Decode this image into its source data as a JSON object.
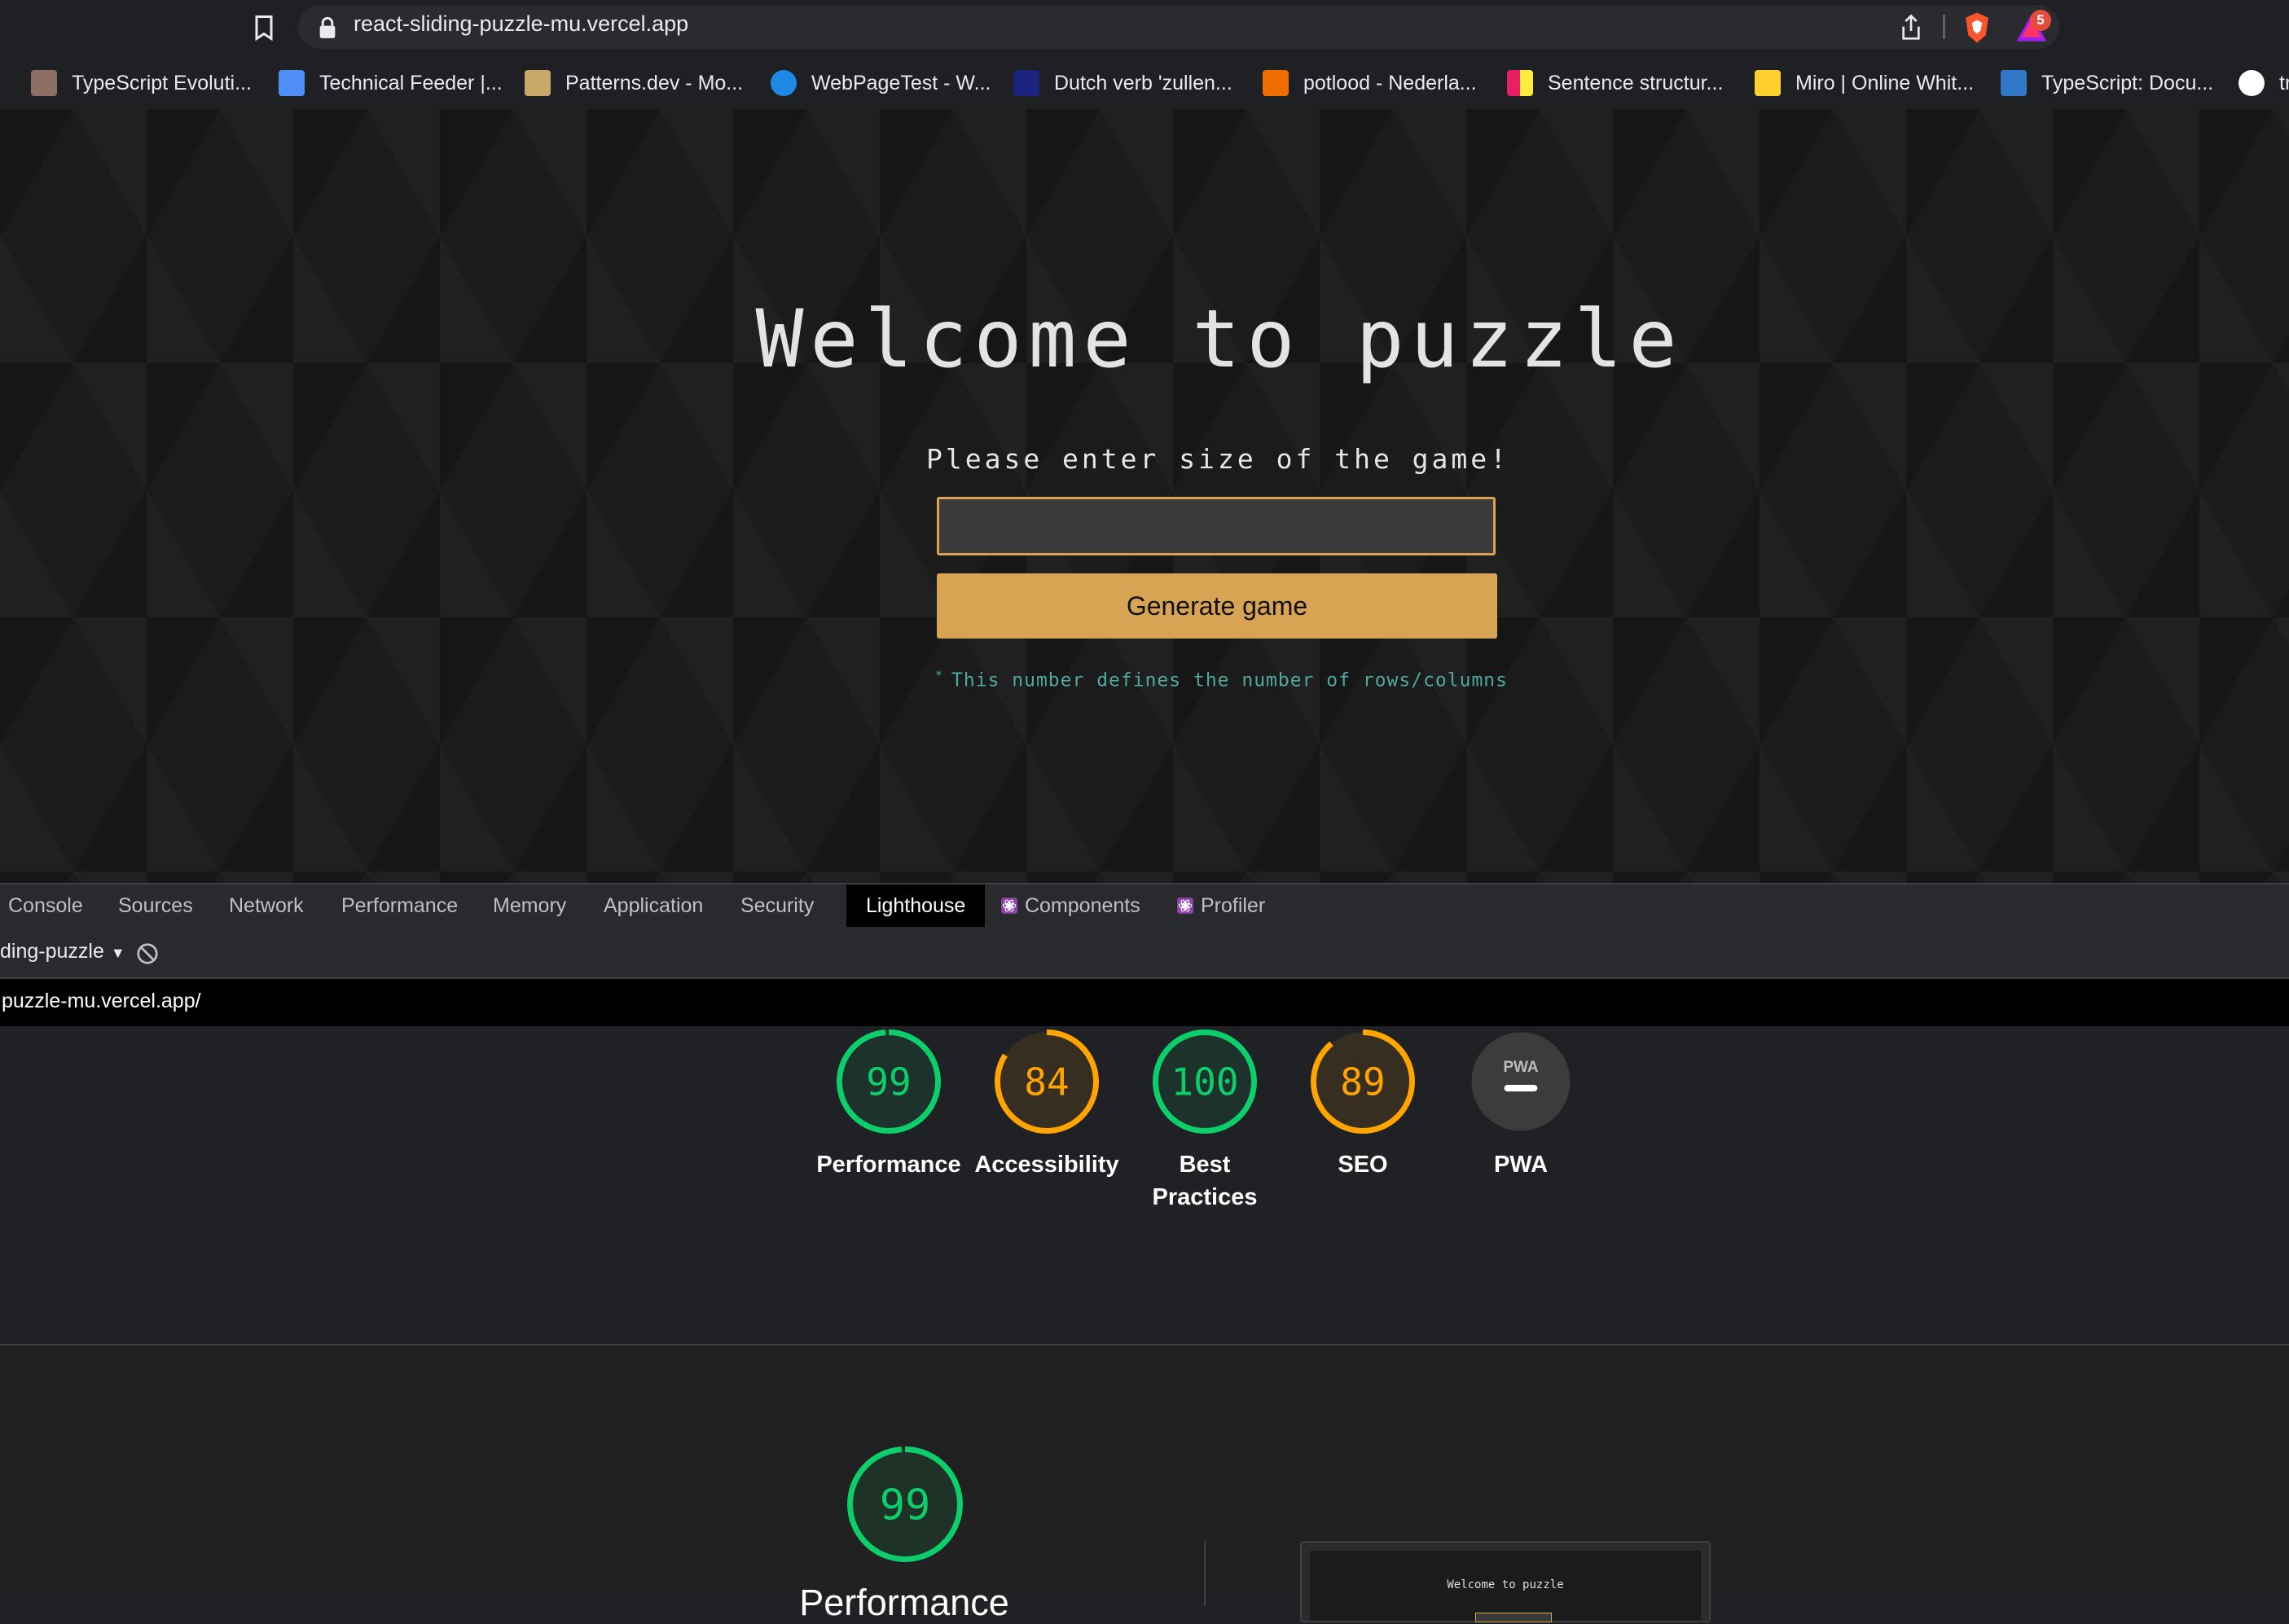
{
  "browser": {
    "url": "react-sliding-puzzle-mu.vercel.app",
    "rewards_badge": "5",
    "bookmarks": [
      {
        "label": "TypeScript Evoluti...",
        "icon": "avatar-favicon",
        "color": "#8d6e63"
      },
      {
        "label": "Technical Feeder |...",
        "icon": "feeder-favicon",
        "color": "#4f8ef7"
      },
      {
        "label": "Patterns.dev - Mo...",
        "icon": "patterns-favicon",
        "color": "#c9a86a"
      },
      {
        "label": "WebPageTest - W...",
        "icon": "webpagetest-favicon",
        "color": "#1e88e5"
      },
      {
        "label": "Dutch verb 'zullen...",
        "icon": "dutch-favicon",
        "color": "#1a237e"
      },
      {
        "label": "potlood - Nederla...",
        "icon": "pencil-favicon",
        "color": "#ef6c00"
      },
      {
        "label": "Sentence structur...",
        "icon": "grid-favicon",
        "color": "#e91e63"
      },
      {
        "label": "Miro | Online Whit...",
        "icon": "miro-favicon",
        "color": "#ffd02f"
      },
      {
        "label": "TypeScript: Docu...",
        "icon": "ts-favicon",
        "color": "#3178c6"
      },
      {
        "label": "tr",
        "icon": "github-favicon",
        "color": "#ffffff"
      }
    ]
  },
  "page": {
    "title": "Welcome to puzzle",
    "prompt": "Please enter size of the game!",
    "input_value": "",
    "button_label": "Generate game",
    "hint_marker": "*",
    "hint": "This number defines the number of rows/columns",
    "accent_color": "#d6a453"
  },
  "devtools": {
    "tabs": [
      {
        "label": "Console"
      },
      {
        "label": "Sources"
      },
      {
        "label": "Network"
      },
      {
        "label": "Performance"
      },
      {
        "label": "Memory"
      },
      {
        "label": "Application"
      },
      {
        "label": "Security"
      },
      {
        "label": "Lighthouse",
        "active": true
      },
      {
        "label": "Components",
        "icon": "react-icon"
      },
      {
        "label": "Profiler",
        "icon": "react-icon"
      }
    ],
    "report_select": "ding-puzzle",
    "report_url": "puzzle-mu.vercel.app/"
  },
  "lighthouse": {
    "scores": [
      {
        "label": "Performance",
        "score": 99,
        "status": "pass"
      },
      {
        "label": "Accessibility",
        "score": 84,
        "status": "average"
      },
      {
        "label": "Best Practices",
        "score": 100,
        "status": "pass"
      },
      {
        "label": "SEO",
        "score": 89,
        "status": "average"
      },
      {
        "label": "PWA",
        "score": null,
        "status": "na",
        "badge_text": "PWA"
      }
    ],
    "performance_section": {
      "score": 99,
      "title": "Performance",
      "thumbnail_title": "Welcome to puzzle"
    },
    "colors": {
      "pass": "#0cce6b",
      "average": "#ffa400",
      "na": "#3c3c3c"
    }
  }
}
